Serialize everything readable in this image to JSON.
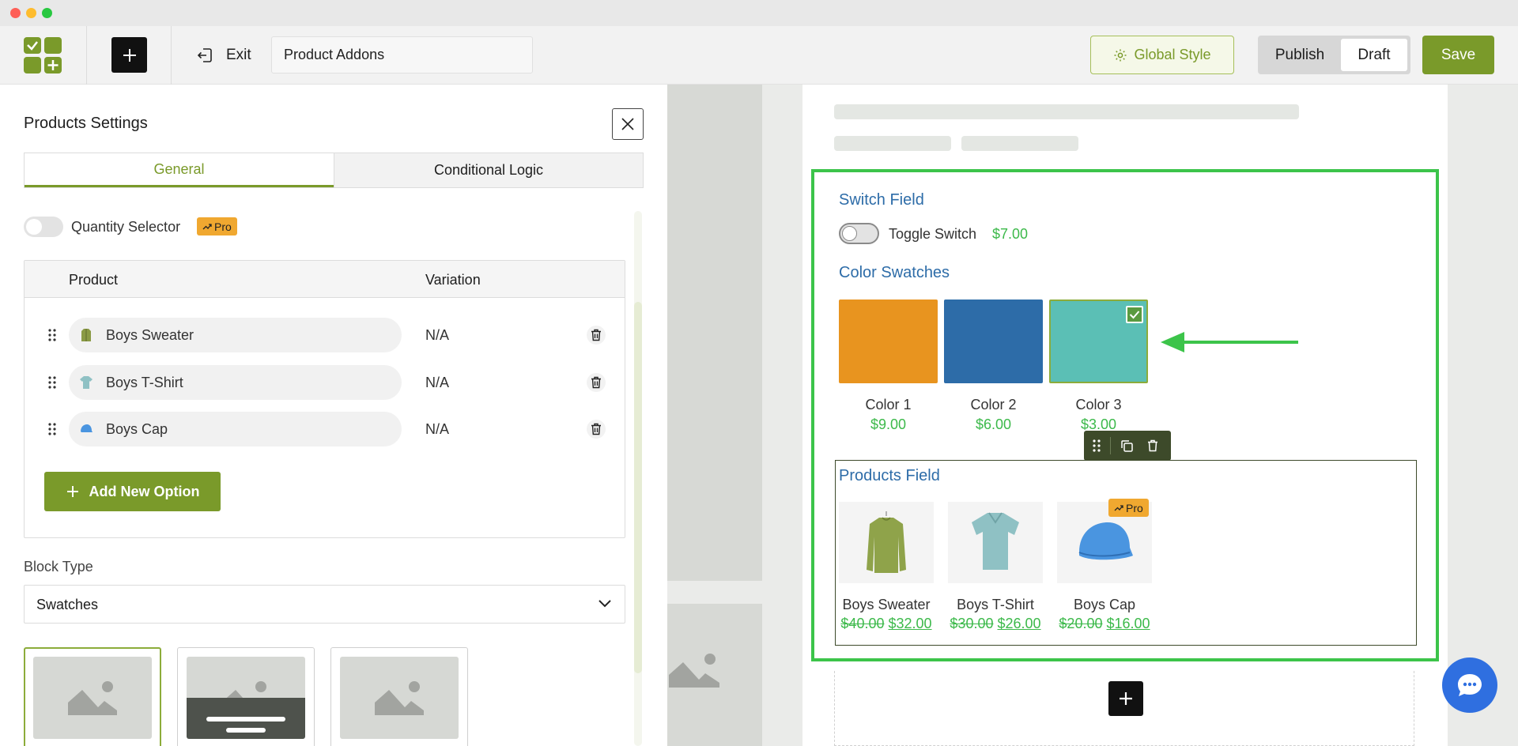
{
  "window": {
    "dots": [
      "#fe5f57",
      "#febc2e",
      "#28c840"
    ]
  },
  "toolbar": {
    "exit_label": "Exit",
    "form_title_value": "Product Addons",
    "global_style_label": "Global Style",
    "publish_label": "Publish",
    "draft_label": "Draft",
    "save_label": "Save"
  },
  "panel": {
    "title": "Products Settings",
    "tabs": [
      {
        "label": "General",
        "active": true
      },
      {
        "label": "Conditional Logic",
        "active": false
      }
    ],
    "quantity_selector": {
      "label": "Quantity Selector",
      "enabled": false,
      "badge": "Pro"
    },
    "table": {
      "headers": [
        "Product",
        "Variation"
      ],
      "rows": [
        {
          "product": "Boys Sweater",
          "variation": "N/A",
          "icon": "sweater-icon"
        },
        {
          "product": "Boys T-Shirt",
          "variation": "N/A",
          "icon": "tshirt-icon"
        },
        {
          "product": "Boys Cap",
          "variation": "N/A",
          "icon": "cap-icon"
        }
      ]
    },
    "add_option_label": "Add New Option",
    "block_type": {
      "label": "Block Type",
      "value": "Swatches"
    }
  },
  "preview": {
    "switch_field": {
      "title": "Switch Field",
      "toggle_label": "Toggle Switch",
      "price": "$7.00",
      "enabled": false
    },
    "color_swatches": {
      "title": "Color Swatches",
      "items": [
        {
          "name": "Color 1",
          "price": "$9.00",
          "color": "#e8941f",
          "selected": false
        },
        {
          "name": "Color 2",
          "price": "$6.00",
          "color": "#2d6ca8",
          "selected": false
        },
        {
          "name": "Color 3",
          "price": "$3.00",
          "color": "#5bbfb5",
          "selected": true
        }
      ]
    },
    "products_field": {
      "title": "Products Field",
      "badge": "Pro",
      "items": [
        {
          "name": "Boys Sweater",
          "old_price": "$40.00",
          "new_price": "$32.00"
        },
        {
          "name": "Boys T-Shirt",
          "old_price": "$30.00",
          "new_price": "$26.00"
        },
        {
          "name": "Boys Cap",
          "old_price": "$20.00",
          "new_price": "$16.00"
        }
      ]
    }
  },
  "colors": {
    "accent": "#7a9a2a",
    "highlight": "#3cc44a",
    "link_blue": "#2d6ca8",
    "price_green": "#3cb94a",
    "pro_badge": "#f0a830",
    "chat": "#2f6fe0"
  }
}
